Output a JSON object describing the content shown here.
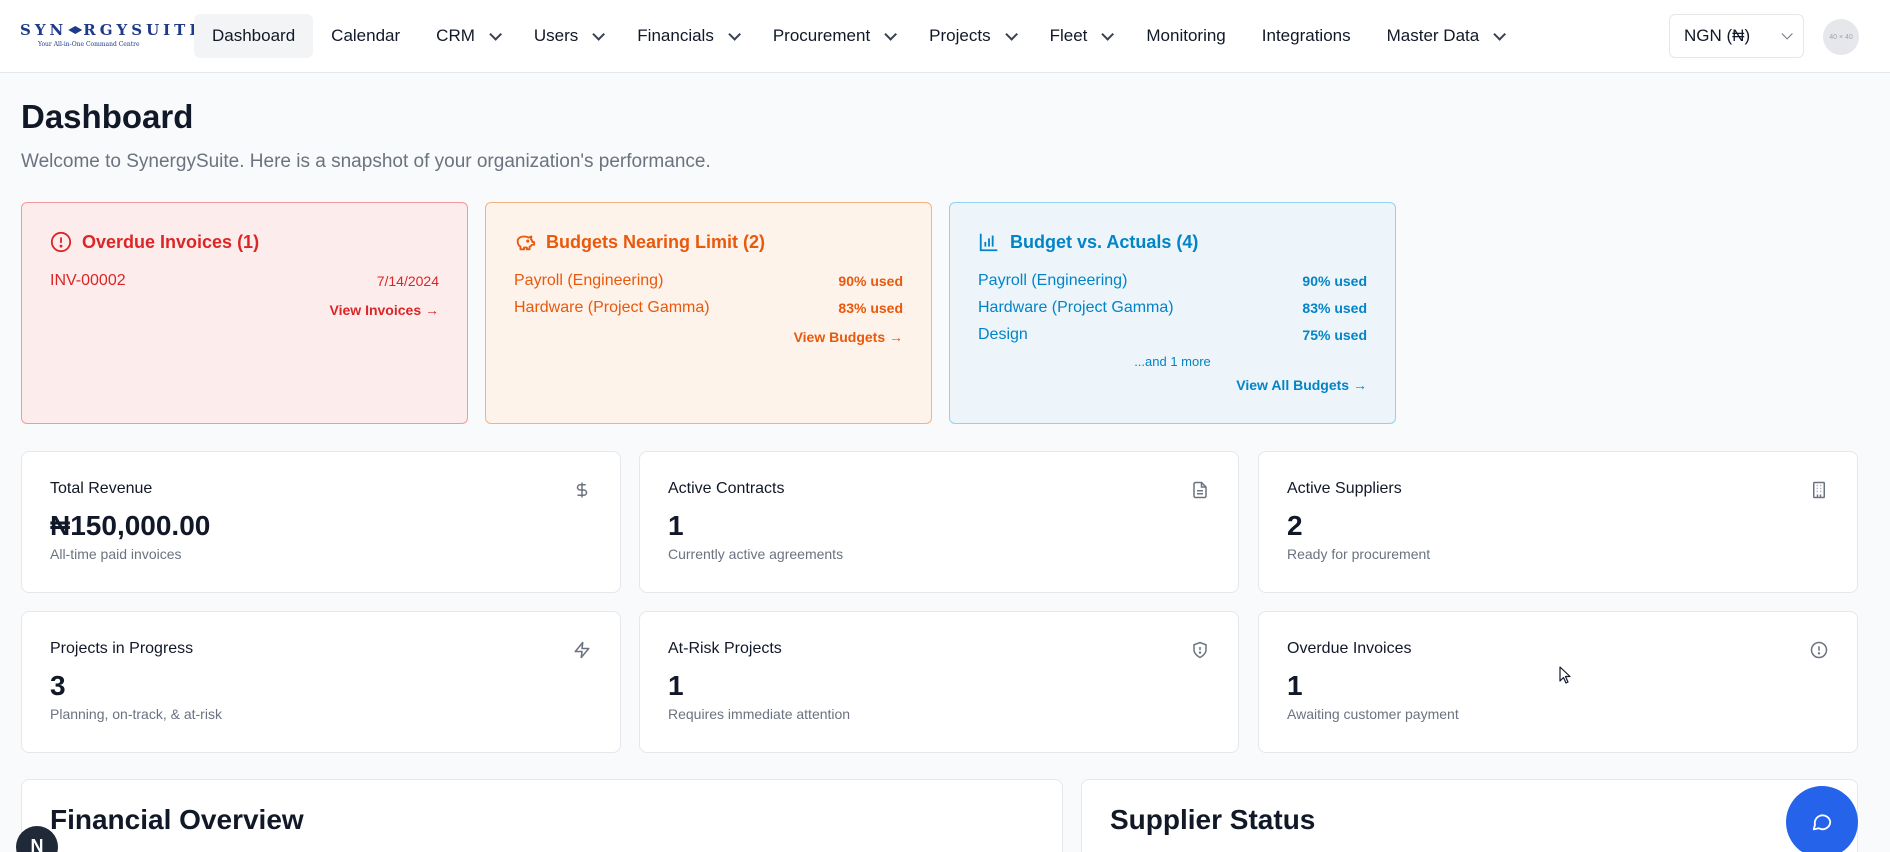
{
  "brand": {
    "name": "SYNERGYSUITE",
    "tagline": "Your All-in-One Command Centre"
  },
  "nav": {
    "items": [
      {
        "label": "Dashboard",
        "dropdown": false,
        "active": true
      },
      {
        "label": "Calendar",
        "dropdown": false
      },
      {
        "label": "CRM",
        "dropdown": true
      },
      {
        "label": "Users",
        "dropdown": true
      },
      {
        "label": "Financials",
        "dropdown": true
      },
      {
        "label": "Procurement",
        "dropdown": true
      },
      {
        "label": "Projects",
        "dropdown": true
      },
      {
        "label": "Fleet",
        "dropdown": true
      },
      {
        "label": "Monitoring",
        "dropdown": false
      },
      {
        "label": "Integrations",
        "dropdown": false
      },
      {
        "label": "Master Data",
        "dropdown": true
      }
    ],
    "currency": "NGN (₦)",
    "avatar_text": "40 × 40"
  },
  "header": {
    "title": "Dashboard",
    "subtitle": "Welcome to SynergySuite. Here is a snapshot of your organization's performance."
  },
  "alerts": {
    "overdue": {
      "title": "Overdue Invoices (1)",
      "rows": [
        {
          "left": "INV-00002",
          "right": "7/14/2024"
        }
      ],
      "link": "View Invoices →",
      "color": "#dc2626"
    },
    "budgets": {
      "title": "Budgets Nearing Limit (2)",
      "rows": [
        {
          "left": "Payroll (Engineering)",
          "right": "90% used"
        },
        {
          "left": "Hardware (Project Gamma)",
          "right": "83% used"
        }
      ],
      "link": "View Budgets →",
      "color": "#ea580c"
    },
    "actuals": {
      "title": "Budget vs. Actuals (4)",
      "rows": [
        {
          "left": "Payroll (Engineering)",
          "right": "90% used"
        },
        {
          "left": "Hardware (Project Gamma)",
          "right": "83% used"
        },
        {
          "left": "Design",
          "right": "75% used"
        }
      ],
      "more": "...and 1 more",
      "link": "View All Budgets →",
      "color": "#0284c7"
    }
  },
  "stats": [
    {
      "label": "Total Revenue",
      "value": "₦150,000.00",
      "desc": "All-time paid invoices",
      "icon": "dollar-icon"
    },
    {
      "label": "Active Contracts",
      "value": "1",
      "desc": "Currently active agreements",
      "icon": "document-icon"
    },
    {
      "label": "Active Suppliers",
      "value": "2",
      "desc": "Ready for procurement",
      "icon": "building-icon"
    },
    {
      "label": "Projects in Progress",
      "value": "3",
      "desc": "Planning, on-track, & at-risk",
      "icon": "lightning-icon"
    },
    {
      "label": "At-Risk Projects",
      "value": "1",
      "desc": "Requires immediate attention",
      "icon": "shield-alert-icon"
    },
    {
      "label": "Overdue Invoices",
      "value": "1",
      "desc": "Awaiting customer payment",
      "icon": "alert-circle-icon"
    }
  ],
  "panels": {
    "financial": "Financial Overview",
    "supplier": "Supplier Status"
  },
  "badge": {
    "letter": "N"
  }
}
